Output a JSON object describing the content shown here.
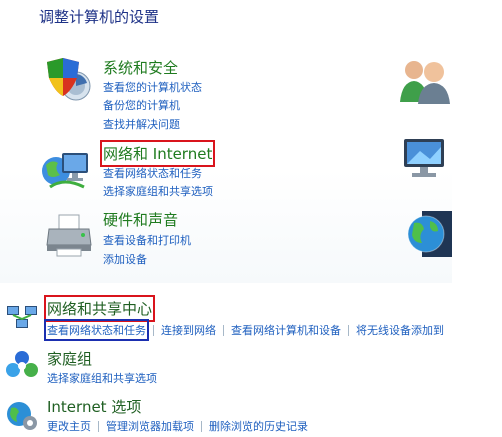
{
  "panel": {
    "title": "调整计算机的设置",
    "categories": [
      {
        "title": "系统和安全",
        "icon": "shield-icon",
        "links": [
          "查看您的计算机状态",
          "备份您的计算机",
          "查找并解决问题"
        ]
      },
      {
        "title": "网络和 Internet",
        "icon": "network-icon",
        "links": [
          "查看网络状态和任务",
          "选择家庭组和共享选项"
        ]
      },
      {
        "title": "硬件和声音",
        "icon": "printer-icon",
        "links": [
          "查看设备和打印机",
          "添加设备"
        ]
      }
    ],
    "right_icons": [
      "users-icon",
      "appearance-icon",
      "globe-icon"
    ]
  },
  "network_page": {
    "sections": [
      {
        "title": "网络和共享中心",
        "icon": "network-sharing-icon",
        "links": [
          "查看网络状态和任务",
          "连接到网络",
          "查看网络计算机和设备",
          "将无线设备添加到"
        ]
      },
      {
        "title": "家庭组",
        "icon": "homegroup-icon",
        "links": [
          "选择家庭组和共享选项"
        ]
      },
      {
        "title": "Internet 选项",
        "icon": "internet-options-icon",
        "links": [
          "更改主页",
          "管理浏览器加载项",
          "删除浏览的历史记录"
        ]
      }
    ]
  },
  "colors": {
    "category_title": "#1f7b1f",
    "link": "#1e5fbf",
    "highlight_red": "#d9141c",
    "highlight_blue": "#1b2fb0"
  }
}
